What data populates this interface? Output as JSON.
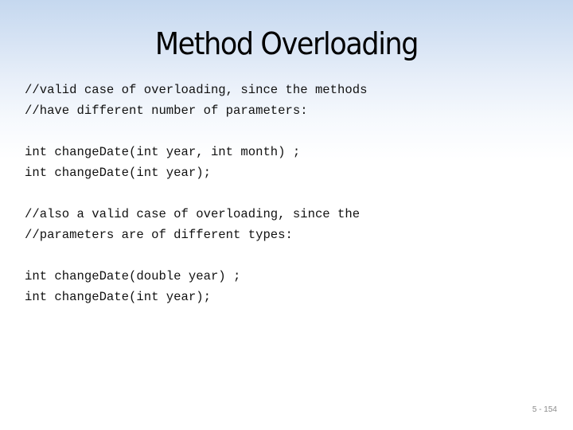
{
  "slide": {
    "title": "Method Overloading",
    "blocks": [
      {
        "lines": [
          "//valid case of overloading, since the methods",
          "//have different number of parameters:"
        ]
      },
      {
        "lines": [
          "int changeDate(int year, int month) ;",
          "int changeDate(int year);"
        ]
      },
      {
        "lines": [
          "//also a valid case of overloading, since the",
          "//parameters are of different types:"
        ]
      },
      {
        "lines": [
          "int changeDate(double year) ;",
          "int changeDate(int year);"
        ]
      }
    ],
    "slide_number": "5 - 154"
  },
  "colors": {
    "background_top": "#c5d8ef",
    "background_bottom": "#ffffff",
    "text": "#111111",
    "slide_number": "#8c8c8c"
  }
}
